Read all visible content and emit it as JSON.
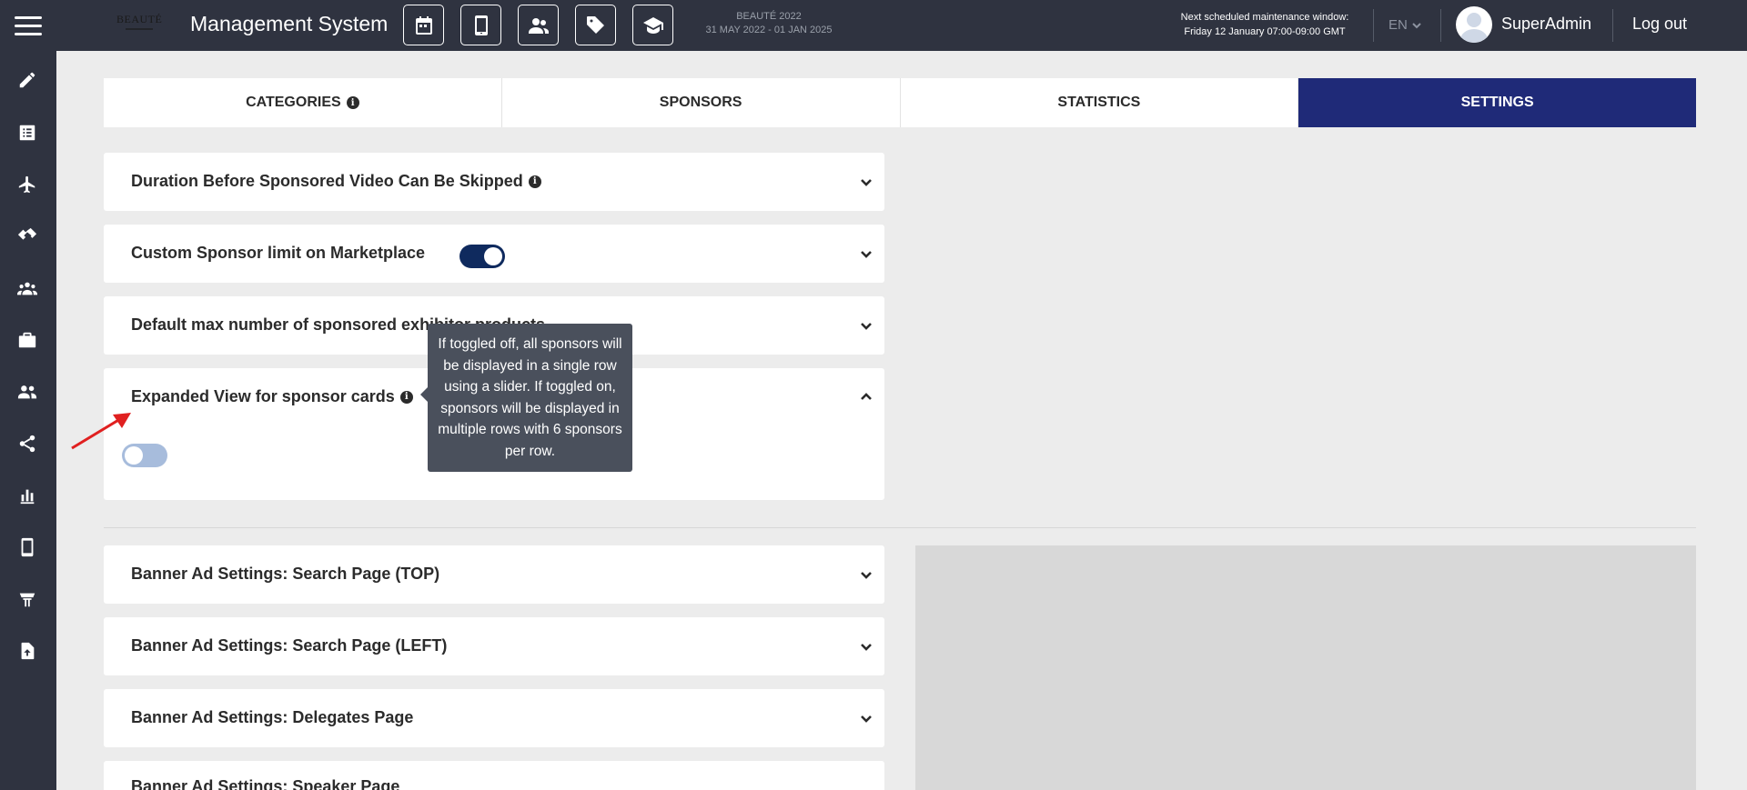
{
  "header": {
    "logo_text": "BEAUTÉ",
    "app_title": "Management System",
    "toolbar_icons": [
      "calendar-icon",
      "mobile-icon",
      "users-icon",
      "tag-icon",
      "graduation-cap-icon"
    ],
    "event_name": "BEAUTÉ 2022",
    "event_dates": "31 MAY 2022 - 01 JAN 2025",
    "maintenance_label": "Next scheduled maintenance window:",
    "maintenance_time": "Friday 12 January 07:00-09:00 GMT",
    "language": "EN",
    "username": "SuperAdmin",
    "logout_label": "Log out"
  },
  "sidebar": {
    "icons": [
      "pencil-icon",
      "list-icon",
      "plane-icon",
      "handshake-icon",
      "group-icon",
      "briefcase-icon",
      "people-icon",
      "share-icon",
      "bar-chart-icon",
      "mobile-icon",
      "booth-icon",
      "file-upload-icon"
    ]
  },
  "tabs": [
    {
      "label": "CATEGORIES",
      "has_info": true,
      "active": false
    },
    {
      "label": "SPONSORS",
      "has_info": false,
      "active": false
    },
    {
      "label": "STATISTICS",
      "has_info": false,
      "active": false
    },
    {
      "label": "SETTINGS",
      "has_info": false,
      "active": true
    }
  ],
  "settings": {
    "duration_skip": {
      "title": "Duration Before Sponsored Video Can Be Skipped",
      "expanded": false
    },
    "custom_limit": {
      "title": "Custom Sponsor limit on Marketplace",
      "toggle_on": true,
      "expanded": false
    },
    "default_max": {
      "title": "Default max number of sponsored exhibitor products",
      "expanded": false
    },
    "expanded_view": {
      "title": "Expanded View for sponsor cards",
      "toggle_on": false,
      "expanded": true
    }
  },
  "tooltip": {
    "text": "If toggled off, all sponsors will be displayed in a single row using a slider. If toggled on, sponsors will be displayed in multiple rows with 6 sponsors per row."
  },
  "banners": [
    {
      "title": "Banner Ad Settings: Search Page (TOP)"
    },
    {
      "title": "Banner Ad Settings: Search Page (LEFT)"
    },
    {
      "title": "Banner Ad Settings: Delegates Page"
    },
    {
      "title": "Banner Ad Settings: Speaker Page"
    }
  ],
  "colors": {
    "topbar": "#2f3340",
    "active_tab": "#1f2a78",
    "toggle_on": "#0f2a5e",
    "toggle_off": "#a7bcdc",
    "annotation_arrow": "#e02020"
  }
}
